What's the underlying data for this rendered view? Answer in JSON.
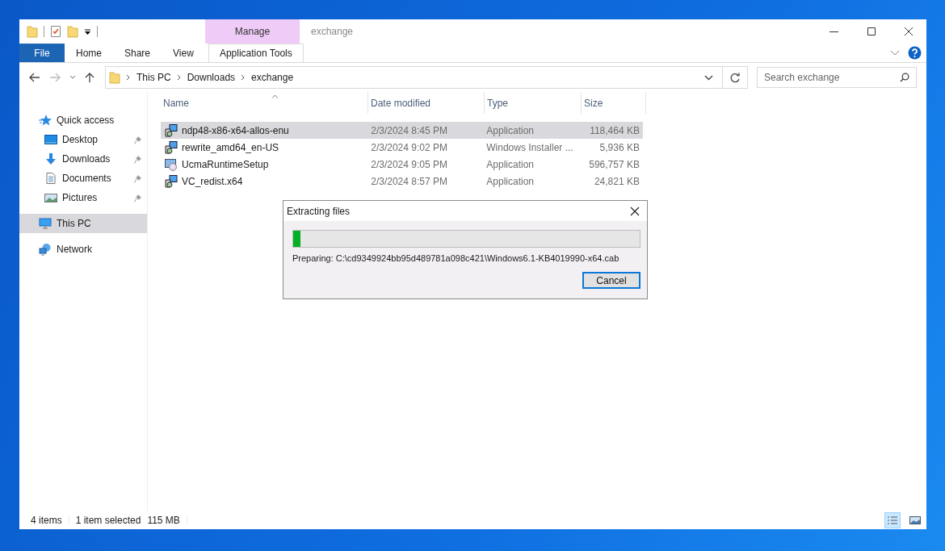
{
  "window": {
    "title": "exchange"
  },
  "ribbon": {
    "contextual_group": "Manage",
    "tabs": [
      {
        "label": "File",
        "kind": "file",
        "selected": false
      },
      {
        "label": "Home",
        "kind": "tab",
        "selected": false
      },
      {
        "label": "Share",
        "kind": "tab",
        "selected": false
      },
      {
        "label": "View",
        "kind": "tab",
        "selected": false
      },
      {
        "label": "Application Tools",
        "kind": "contextual",
        "selected": false
      }
    ]
  },
  "address": {
    "breadcrumb": [
      "This PC",
      "Downloads",
      "exchange"
    ]
  },
  "search": {
    "placeholder": "Search exchange"
  },
  "sidebar": {
    "items": [
      {
        "label": "Quick access",
        "kind": "star",
        "selected": false,
        "children": [
          {
            "label": "Desktop",
            "kind": "desktop",
            "pinned": true,
            "selected": false
          },
          {
            "label": "Downloads",
            "kind": "download",
            "pinned": true,
            "selected": false
          },
          {
            "label": "Documents",
            "kind": "document",
            "pinned": true,
            "selected": false
          },
          {
            "label": "Pictures",
            "kind": "picture",
            "pinned": true,
            "selected": false
          }
        ]
      },
      {
        "label": "This PC",
        "kind": "pc",
        "selected": true
      },
      {
        "label": "Network",
        "kind": "network",
        "selected": false
      }
    ]
  },
  "table": {
    "columns": [
      "Name",
      "Date modified",
      "Type",
      "Size"
    ],
    "rows": [
      {
        "name": "ndp48-x86-x64-allos-enu",
        "date": "2/3/2024 8:45 PM",
        "type": "Application",
        "size": "118,464 KB",
        "kind": "installer",
        "selected": true
      },
      {
        "name": "rewrite_amd64_en-US",
        "date": "2/3/2024 9:02 PM",
        "type": "Windows Installer ...",
        "size": "5,936 KB",
        "kind": "installer",
        "selected": false
      },
      {
        "name": "UcmaRuntimeSetup",
        "date": "2/3/2024 9:05 PM",
        "type": "Application",
        "size": "596,757 KB",
        "kind": "setup",
        "selected": false
      },
      {
        "name": "VC_redist.x64",
        "date": "2/3/2024 8:57 PM",
        "type": "Application",
        "size": "24,821 KB",
        "kind": "installer",
        "selected": false
      }
    ]
  },
  "dialog": {
    "title": "Extracting files",
    "level": 0.02,
    "status": "Preparing: C:\\cd9349924bb95d489781a098c421\\Windows6.1-KB4019990-x64.cab",
    "button": "Cancel"
  },
  "status_bar": {
    "item_count": "4 items",
    "selection": "1 item selected",
    "selection_size": "115 MB",
    "views": [
      {
        "kind": "details",
        "selected": true
      },
      {
        "kind": "large",
        "selected": false
      }
    ]
  }
}
